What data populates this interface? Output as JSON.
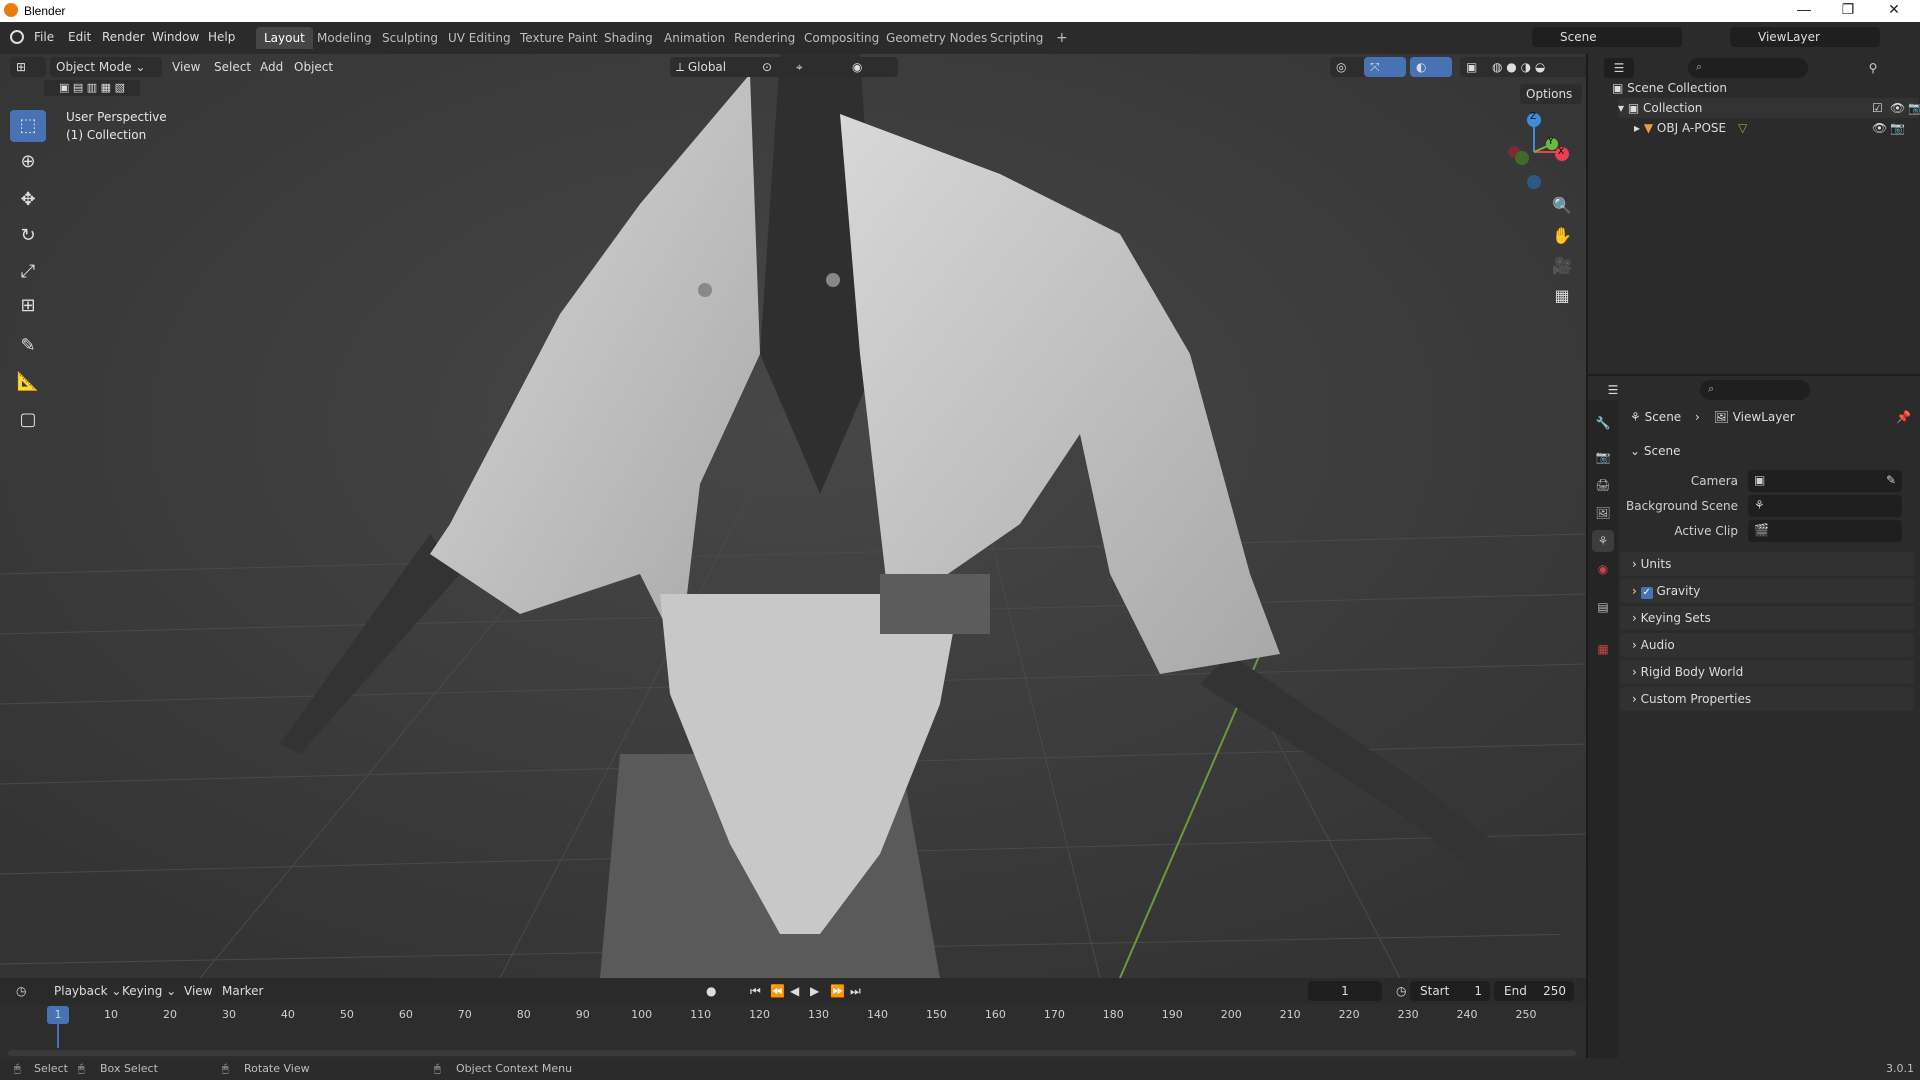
{
  "titlebar": {
    "title": "Blender",
    "min": "—",
    "max": "❐",
    "close": "✕"
  },
  "menu": [
    "File",
    "Edit",
    "Render",
    "Window",
    "Help"
  ],
  "workspaces": [
    "Layout",
    "Modeling",
    "Sculpting",
    "UV Editing",
    "Texture Paint",
    "Shading",
    "Animation",
    "Rendering",
    "Compositing",
    "Geometry Nodes",
    "Scripting"
  ],
  "workspace_add": "+",
  "scene_field": "Scene",
  "viewlayer_field": "ViewLayer",
  "viewport": {
    "mode": "Object Mode",
    "menus": [
      "View",
      "Select",
      "Add",
      "Object"
    ],
    "orientation": "Global",
    "options": "Options",
    "info_line1": "User Perspective",
    "info_line2": "(1) Collection",
    "gizmo": {
      "z": "Z",
      "y": "Y",
      "x": "X"
    }
  },
  "outliner": {
    "scene_collection": "Scene Collection",
    "collection": "Collection",
    "object": "OBJ A-POSE"
  },
  "properties": {
    "breadcrumb_scene": "Scene",
    "breadcrumb_viewlayer": "ViewLayer",
    "section": "Scene",
    "camera_label": "Camera",
    "background_label": "Background Scene",
    "active_clip_label": "Active Clip",
    "panels": [
      "Units",
      "Gravity",
      "Keying Sets",
      "Audio",
      "Rigid Body World",
      "Custom Properties"
    ],
    "gravity_checked": true
  },
  "timeline": {
    "menus": [
      "Playback",
      "Keying",
      "View",
      "Marker"
    ],
    "current_frame": "1",
    "start_label": "Start",
    "start": "1",
    "end_label": "End",
    "end": "250",
    "ticks": [
      "1",
      "10",
      "20",
      "30",
      "40",
      "50",
      "60",
      "70",
      "80",
      "90",
      "100",
      "110",
      "120",
      "130",
      "140",
      "150",
      "160",
      "170",
      "180",
      "190",
      "200",
      "210",
      "220",
      "230",
      "240",
      "250"
    ]
  },
  "statusbar": {
    "select": "Select",
    "box_select": "Box Select",
    "rotate_view": "Rotate View",
    "context_menu": "Object Context Menu",
    "version": "3.0.1"
  },
  "colors": {
    "accent": "#4772b3",
    "active_frame": "#4772b3",
    "x_axis": "#e8414f",
    "y_axis": "#6cb93f",
    "z_axis": "#3a8fd6"
  }
}
